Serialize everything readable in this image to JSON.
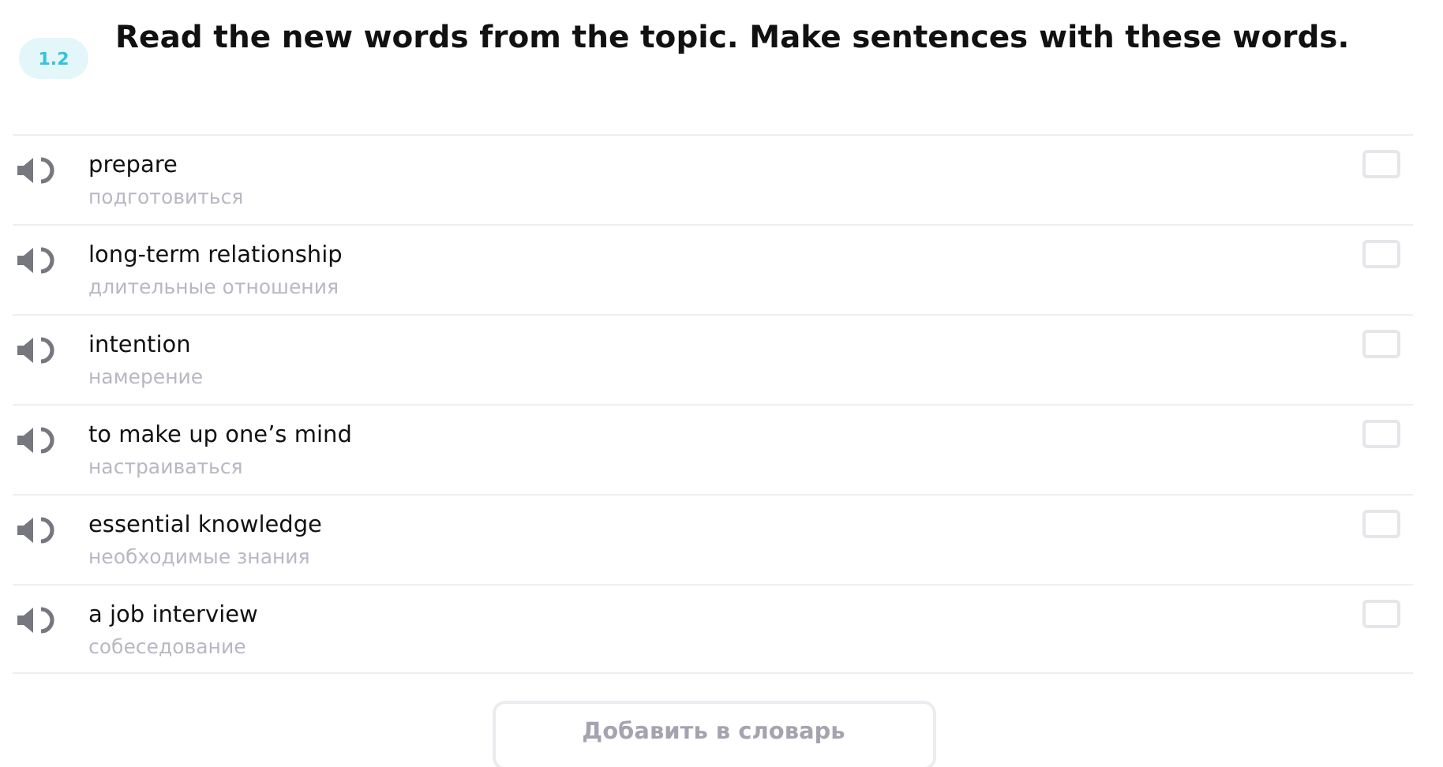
{
  "task": {
    "number": "1.2",
    "title": "Read the new words from the topic. Make sentences with these words."
  },
  "words": [
    {
      "word": "prepare",
      "translation": "подготовиться",
      "checked": false
    },
    {
      "word": "long-term relationship",
      "translation": "длительные отношения",
      "checked": false
    },
    {
      "word": "intention",
      "translation": "намерение",
      "checked": false
    },
    {
      "word": "to make up one’s mind",
      "translation": "настраиваться",
      "checked": false
    },
    {
      "word": "essential knowledge",
      "translation": "необходимые знания",
      "checked": false
    },
    {
      "word": "a job interview",
      "translation": "собеседование",
      "checked": false
    }
  ],
  "add_button": {
    "label": "Добавить в словарь",
    "disabled": true
  }
}
